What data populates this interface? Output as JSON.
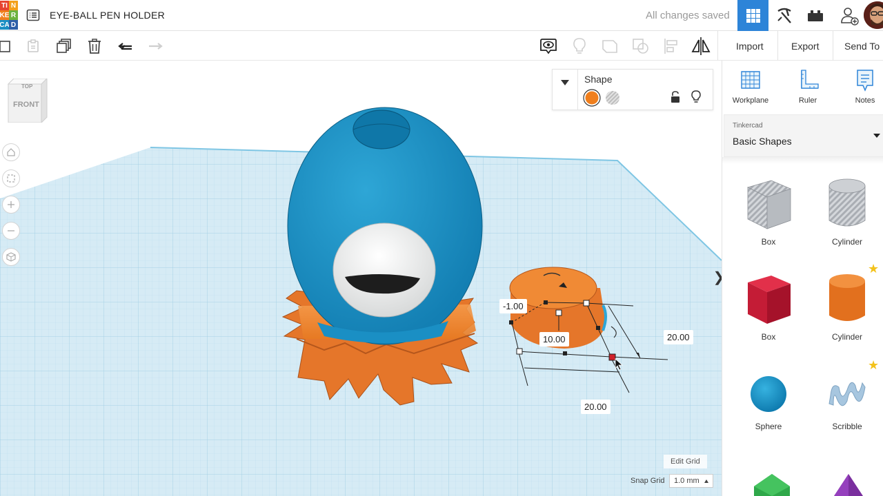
{
  "topbar": {
    "logo_letters": [
      "T",
      "I",
      "N",
      "K",
      "E",
      "R",
      "C",
      "A",
      "D"
    ],
    "logo_cells": [
      "TI",
      "N",
      "KE",
      "R",
      "CA",
      "D"
    ],
    "document_title": "EYE-BALL PEN HOLDER",
    "save_status": "All changes saved",
    "icons": [
      "3d-design-grid-icon",
      "codeblocks-pickaxe-icon",
      "lego-brick-icon",
      "add-user-icon",
      "avatar"
    ]
  },
  "toolbar": {
    "left_tools": [
      "copy-icon",
      "paste-icon",
      "duplicate-icon",
      "delete-icon",
      "undo-icon",
      "redo-icon"
    ],
    "right_tools": [
      "show-hide-icon",
      "lightbulb-icon",
      "group-icon",
      "ungroup-icon",
      "align-icon",
      "mirror-icon"
    ],
    "import_label": "Import",
    "export_label": "Export",
    "send_to_label": "Send To"
  },
  "viewport": {
    "viewcube": {
      "top_label": "TOP",
      "front_label": "FRONT"
    },
    "nav_buttons": [
      "home-view-icon",
      "fit-view-icon",
      "zoom-in-icon",
      "zoom-out-icon",
      "perspective-icon"
    ],
    "shape_panel": {
      "title": "Shape",
      "solid_color": "#f07f1d",
      "hole_label": "hole"
    },
    "dimensions": {
      "elevation": "-1.00",
      "height": "10.00",
      "width": "20.00",
      "length": "20.00"
    },
    "edit_grid_label": "Edit Grid",
    "snap_grid_label": "Snap Grid",
    "snap_grid_value": "1.0 mm"
  },
  "rightpanel": {
    "tools": [
      {
        "label": "Workplane",
        "icon": "workplane-icon"
      },
      {
        "label": "Ruler",
        "icon": "ruler-icon"
      },
      {
        "label": "Notes",
        "icon": "notes-icon"
      }
    ],
    "library_provider": "Tinkercad",
    "library_name": "Basic Shapes",
    "parts": [
      {
        "label": "Box",
        "kind": "hole-box"
      },
      {
        "label": "Cylinder",
        "kind": "hole-cylinder"
      },
      {
        "label": "Box",
        "kind": "box"
      },
      {
        "label": "Cylinder",
        "kind": "cylinder"
      },
      {
        "label": "Sphere",
        "kind": "sphere"
      },
      {
        "label": "Scribble",
        "kind": "scribble"
      }
    ]
  },
  "colors": {
    "accent_blue": "#2d84d8",
    "shape_orange": "#f07f1d",
    "shape_blue": "#1a8fc4",
    "grid_floor": "#cfe7f3"
  }
}
